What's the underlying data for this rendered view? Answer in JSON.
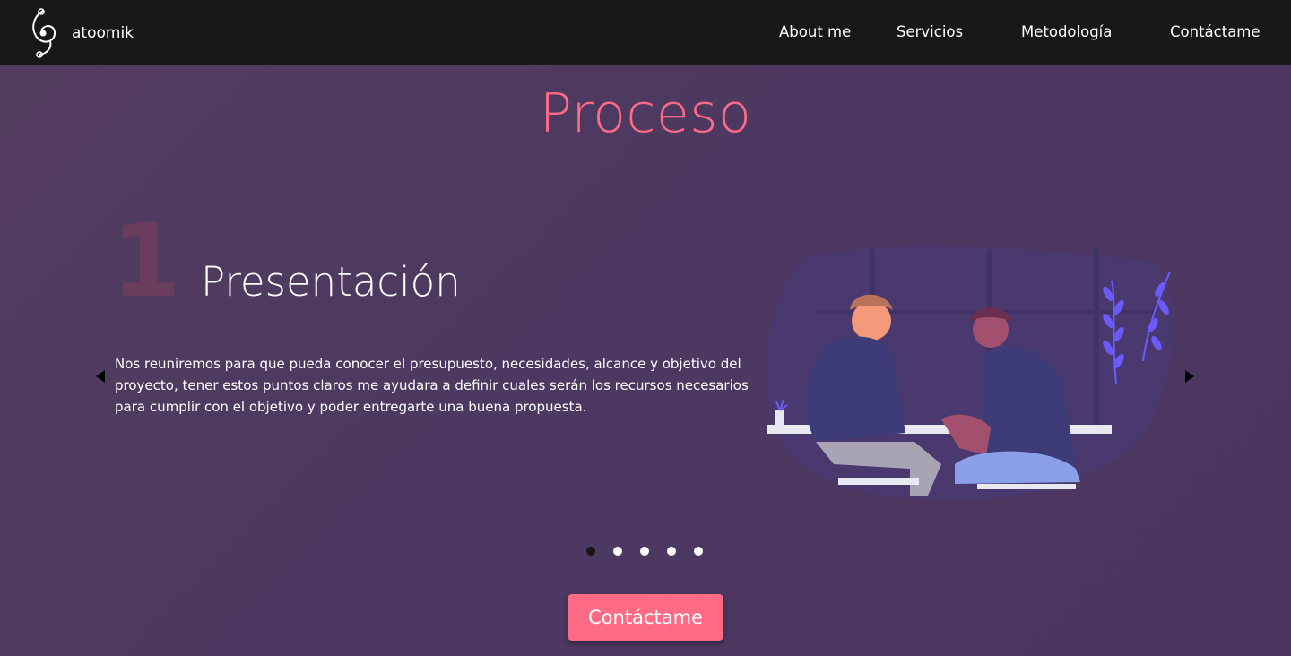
{
  "brand": {
    "name": "atoomik",
    "logo_icon": "atoomik-logo-icon"
  },
  "nav": {
    "links": [
      {
        "label": "About me"
      },
      {
        "label": "Servicios"
      },
      {
        "label": "Metodología"
      },
      {
        "label": "Contáctame"
      }
    ]
  },
  "section": {
    "title": "Proceso"
  },
  "slider": {
    "current_index": 1,
    "total_slides": 5,
    "step": {
      "number": "1",
      "title": "Presentación",
      "description": "Nos reuniremos para que pueda conocer el presupuesto, necesidades, alcance y objetivo del proyecto, tener estos puntos claros me ayudara a definir cuales serán los recursos necesarios para cumplir con el objetivo y poder entregarte una buena propuesta."
    },
    "prev_icon": "triangle-left-icon",
    "next_icon": "triangle-right-icon",
    "illustration": "two-people-meeting-illustration"
  },
  "cta": {
    "label": "Contáctame"
  },
  "colors": {
    "accent": "#ff6a85",
    "navbar_bg": "#181818",
    "page_bg": "#4f3a60",
    "step_number": "#6b3d5c"
  }
}
